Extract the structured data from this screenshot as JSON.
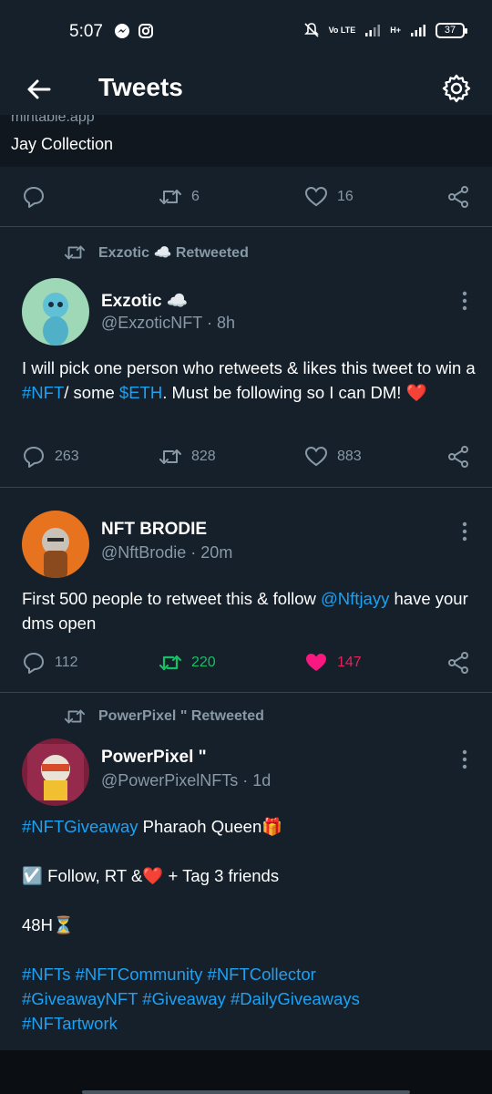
{
  "status_bar": {
    "time": "5:07",
    "battery": "37",
    "network_label": "Vo LTE",
    "signal_label": "H+"
  },
  "header": {
    "title": "Tweets"
  },
  "partial_tweet": {
    "domain_text": "mintable.app",
    "card_title": "Jay Collection",
    "reply_count": "",
    "retweet_count": "6",
    "like_count": "16"
  },
  "tweets": [
    {
      "retweeted_by": "Exzotic ☁️ Retweeted",
      "display_name": "Exzotic ☁️",
      "handle_time": "@ExzoticNFT · 8h",
      "text_segments": [
        {
          "text": "I will pick one person who retweets & likes this tweet to win a "
        },
        {
          "text": "#NFT",
          "link": true
        },
        {
          "text": "/ some "
        },
        {
          "text": "$ETH",
          "link": true
        },
        {
          "text": ". Must be following so I can DM! ❤️"
        }
      ],
      "reply_count": "263",
      "retweet_count": "828",
      "like_count": "883",
      "avatar_colors": [
        "#6fd0c4",
        "#a8e6a0"
      ]
    },
    {
      "retweeted_by": "",
      "display_name": "NFT BRODIE",
      "handle_time": "@NftBrodie · 20m",
      "text_segments": [
        {
          "text": "First 500 people to retweet this & follow "
        },
        {
          "text": "@Nftjayy",
          "link": true
        },
        {
          "text": " have your dms open"
        }
      ],
      "reply_count": "112",
      "retweet_count": "220",
      "like_count": "147",
      "avatar_colors": [
        "#e8731f",
        "#f3a64a"
      ]
    },
    {
      "retweeted_by": "PowerPixel \" Retweeted",
      "display_name": "PowerPixel \"",
      "handle_time": "@PowerPixelNFTs · 1d",
      "lines": [
        [
          {
            "text": "#NFTGiveaway",
            "link": true
          },
          {
            "text": " Pharaoh Queen🎁"
          }
        ],
        [],
        [
          {
            "text": "☑️ Follow, RT &❤️ + Tag 3 friends"
          }
        ],
        [],
        [
          {
            "text": "48H⏳"
          }
        ],
        [],
        [
          {
            "text": "#NFTs #NFTCommunity #NFTCollector",
            "link": true
          }
        ],
        [
          {
            "text": "#GiveawayNFT #Giveaway #DailyGiveaways",
            "link": true
          }
        ],
        [
          {
            "text": "#NFTartwork",
            "link": true
          }
        ]
      ],
      "avatar_colors": [
        "#7a1f3a",
        "#c2476b"
      ]
    }
  ],
  "colors": {
    "background": "#15202b",
    "text_secondary": "#8899a6",
    "link": "#1da1f2",
    "retweet_active": "#17bf63",
    "like_active": "#e0245e"
  }
}
